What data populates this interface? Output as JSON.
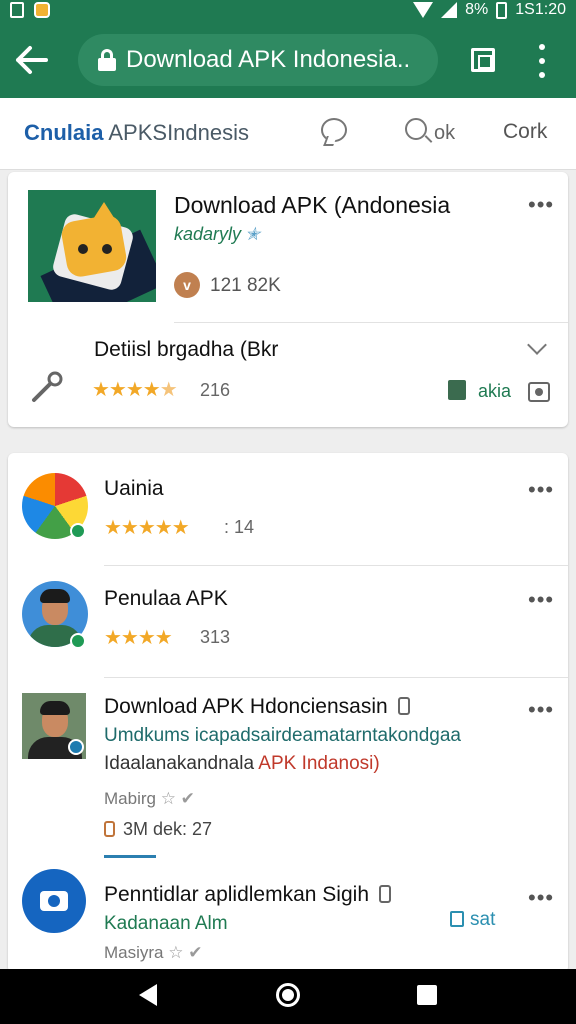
{
  "status_bar": {
    "battery_text": "8%",
    "time": "1S1:20"
  },
  "browser": {
    "url_title": "Download APK Indonesia.."
  },
  "site_nav": {
    "brand_bold": "Cnulaia",
    "brand_rest": "APKSIndnesis",
    "search_label": "ok",
    "cork_label": "Cork"
  },
  "featured": {
    "title": "Download APK (Andonesia",
    "developer": "kadaryly",
    "download_count": "121 82K",
    "detail_title": "Detiisl brgadha (Bkr",
    "rating_count": "216",
    "action_label": "akia",
    "stars_filled": 5
  },
  "apps": [
    {
      "title": "Uainia",
      "rating_count": "14",
      "stars": "★★★★★"
    },
    {
      "title": "Penulaa APK",
      "rating_count": "313",
      "stars": "★★★★"
    },
    {
      "title": "Download APK Hdonciensasin",
      "desc1": "Umdkums icapadsairdeamatarntakondgaa",
      "desc2_prefix": "Idaalanakandnala ",
      "desc2_highlight": "APK Indanosi)",
      "meta": "Mabirg",
      "size": "3M dek:",
      "size_count": "27"
    },
    {
      "title": "Penntidlar aplidlemkan Sigih",
      "desc1": "Kadanaan Alm",
      "meta": "Masiyra",
      "sat_label": "sat"
    }
  ],
  "icons": [
    "back-arrow-icon",
    "lock-icon",
    "tabs-icon",
    "more-icon",
    "chat-icon",
    "search-icon",
    "mic-icon",
    "camera-icon",
    "chevron-down-icon",
    "nav-back-icon",
    "nav-home-icon",
    "nav-recent-icon"
  ],
  "colors": {
    "brand_green": "#1f7a52",
    "star": "#f2a827",
    "link_blue": "#1d5fa8"
  }
}
